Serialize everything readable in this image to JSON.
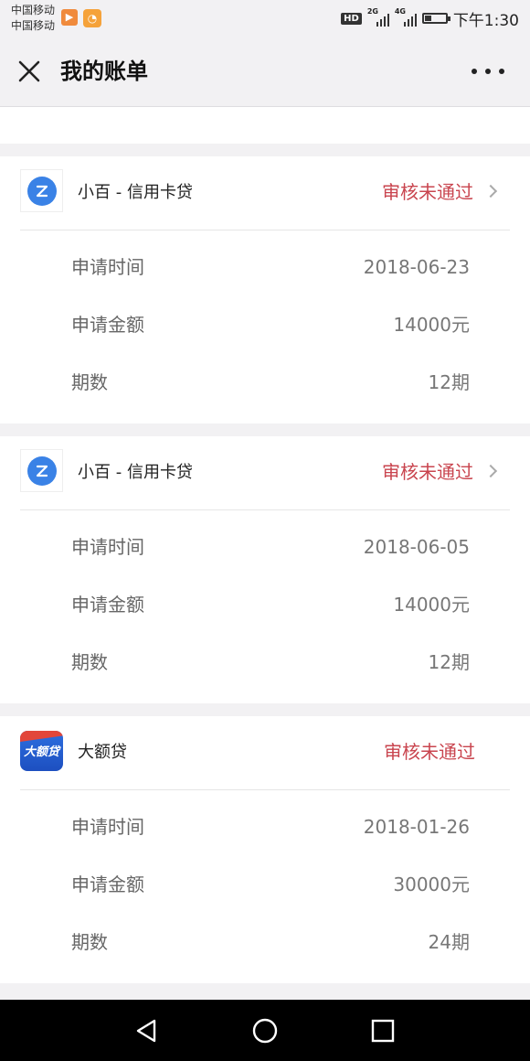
{
  "status_bar": {
    "carrier_1": "中国移动",
    "carrier_2": "中国移动",
    "hd": "HD",
    "net_1": "2G",
    "net_2": "4G",
    "time": "下午1:30",
    "battery_level": 0.3
  },
  "header": {
    "title": "我的账单",
    "close_icon": "close-icon",
    "more_icon": "more-horizontal-icon"
  },
  "loans": [
    {
      "name": "小百 - 信用卡贷",
      "status": "审核未通过",
      "logo": "xiaobai-logo",
      "has_arrow": true,
      "rows": [
        {
          "label": "申请时间",
          "value": "2018-06-23"
        },
        {
          "label": "申请金额",
          "value": "14000元"
        },
        {
          "label": "期数",
          "value": "12期"
        }
      ]
    },
    {
      "name": "小百 - 信用卡贷",
      "status": "审核未通过",
      "logo": "xiaobai-logo",
      "has_arrow": true,
      "rows": [
        {
          "label": "申请时间",
          "value": "2018-06-05"
        },
        {
          "label": "申请金额",
          "value": "14000元"
        },
        {
          "label": "期数",
          "value": "12期"
        }
      ]
    },
    {
      "name": "大额贷",
      "status": "审核未通过",
      "logo": "dae-dai-logo",
      "logo_text": "大额贷",
      "has_arrow": false,
      "rows": [
        {
          "label": "申请时间",
          "value": "2018-01-26"
        },
        {
          "label": "申请金额",
          "value": "30000元"
        },
        {
          "label": "期数",
          "value": "24期"
        }
      ]
    }
  ],
  "colors": {
    "status_red": "#c9454f",
    "page_bg": "#f2f1f3",
    "card_bg": "#ffffff"
  },
  "nav": {
    "back_icon": "back-triangle-icon",
    "home_icon": "home-circle-icon",
    "recents_icon": "recents-square-icon"
  }
}
